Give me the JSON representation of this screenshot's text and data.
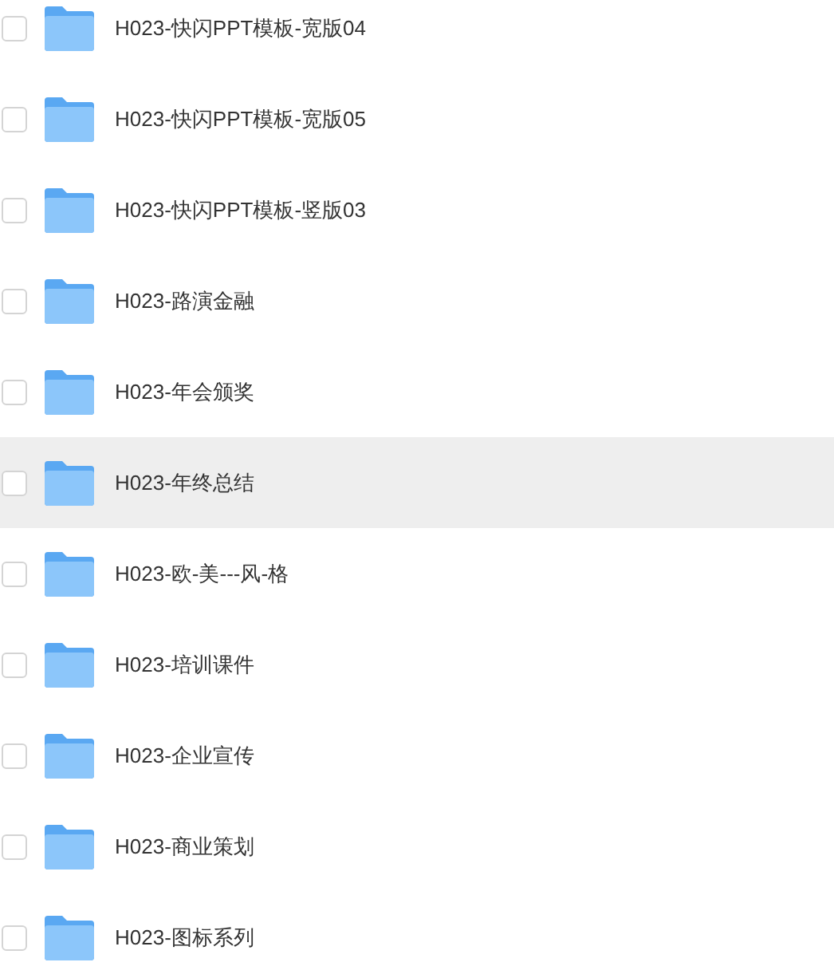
{
  "files": [
    {
      "name": "H023-快闪PPT模板-宽版04",
      "checked": false,
      "highlighted": false
    },
    {
      "name": "H023-快闪PPT模板-宽版05",
      "checked": false,
      "highlighted": false
    },
    {
      "name": "H023-快闪PPT模板-竖版03",
      "checked": false,
      "highlighted": false
    },
    {
      "name": "H023-路演金融",
      "checked": false,
      "highlighted": false
    },
    {
      "name": "H023-年会颁奖",
      "checked": false,
      "highlighted": false
    },
    {
      "name": "H023-年终总结",
      "checked": false,
      "highlighted": true
    },
    {
      "name": "H023-欧-美---风-格",
      "checked": false,
      "highlighted": false
    },
    {
      "name": "H023-培训课件",
      "checked": false,
      "highlighted": false
    },
    {
      "name": "H023-企业宣传",
      "checked": false,
      "highlighted": false
    },
    {
      "name": "H023-商业策划",
      "checked": false,
      "highlighted": false
    },
    {
      "name": "H023-图标系列",
      "checked": false,
      "highlighted": false
    }
  ]
}
